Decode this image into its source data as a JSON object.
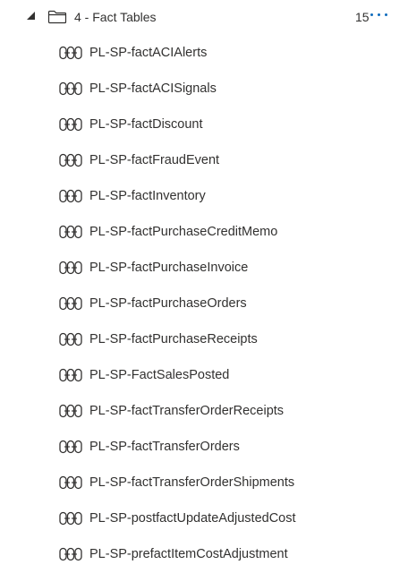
{
  "folder": {
    "label": "4 - Fact Tables",
    "count": "15",
    "expanded": true,
    "icon": "folder-icon",
    "more_icon": "more-options-icon"
  },
  "items": [
    {
      "label": "PL-SP-factACIAlerts",
      "icon": "pipeline-icon"
    },
    {
      "label": "PL-SP-factACISignals",
      "icon": "pipeline-icon"
    },
    {
      "label": "PL-SP-factDiscount",
      "icon": "pipeline-icon"
    },
    {
      "label": "PL-SP-factFraudEvent",
      "icon": "pipeline-icon"
    },
    {
      "label": "PL-SP-factInventory",
      "icon": "pipeline-icon"
    },
    {
      "label": "PL-SP-factPurchaseCreditMemo",
      "icon": "pipeline-icon"
    },
    {
      "label": "PL-SP-factPurchaseInvoice",
      "icon": "pipeline-icon"
    },
    {
      "label": "PL-SP-factPurchaseOrders",
      "icon": "pipeline-icon"
    },
    {
      "label": "PL-SP-factPurchaseReceipts",
      "icon": "pipeline-icon"
    },
    {
      "label": "PL-SP-FactSalesPosted",
      "icon": "pipeline-icon"
    },
    {
      "label": "PL-SP-factTransferOrderReceipts",
      "icon": "pipeline-icon"
    },
    {
      "label": "PL-SP-factTransferOrders",
      "icon": "pipeline-icon"
    },
    {
      "label": "PL-SP-factTransferOrderShipments",
      "icon": "pipeline-icon"
    },
    {
      "label": "PL-SP-postfactUpdateAdjustedCost",
      "icon": "pipeline-icon"
    },
    {
      "label": "PL-SP-prefactItemCostAdjustment",
      "icon": "pipeline-icon"
    }
  ],
  "colors": {
    "text": "#323130",
    "accent": "#0f6cbd",
    "background": "#ffffff"
  }
}
